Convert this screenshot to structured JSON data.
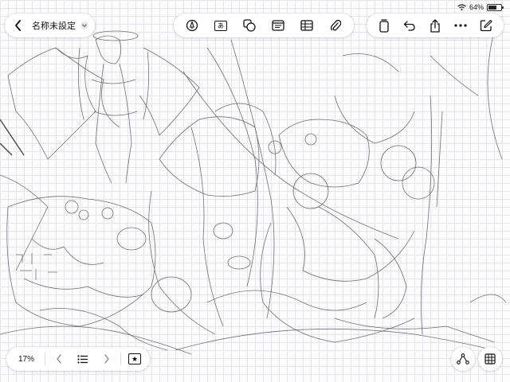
{
  "status": {
    "battery_text": "64%",
    "battery_level": 0.64
  },
  "header": {
    "title": "名称未設定"
  },
  "tools": [
    {
      "name": "pen-tool-icon"
    },
    {
      "name": "text-box-icon",
      "glyph": "あ"
    },
    {
      "name": "shapes-icon"
    },
    {
      "name": "sticky-note-icon"
    },
    {
      "name": "table-icon"
    },
    {
      "name": "attach-icon"
    }
  ],
  "right_tools": [
    "copy-page-icon",
    "undo-icon",
    "share-icon",
    "more-icon",
    "edit-icon"
  ],
  "footer": {
    "zoom": "17%",
    "bookmark_glyph": "★"
  }
}
